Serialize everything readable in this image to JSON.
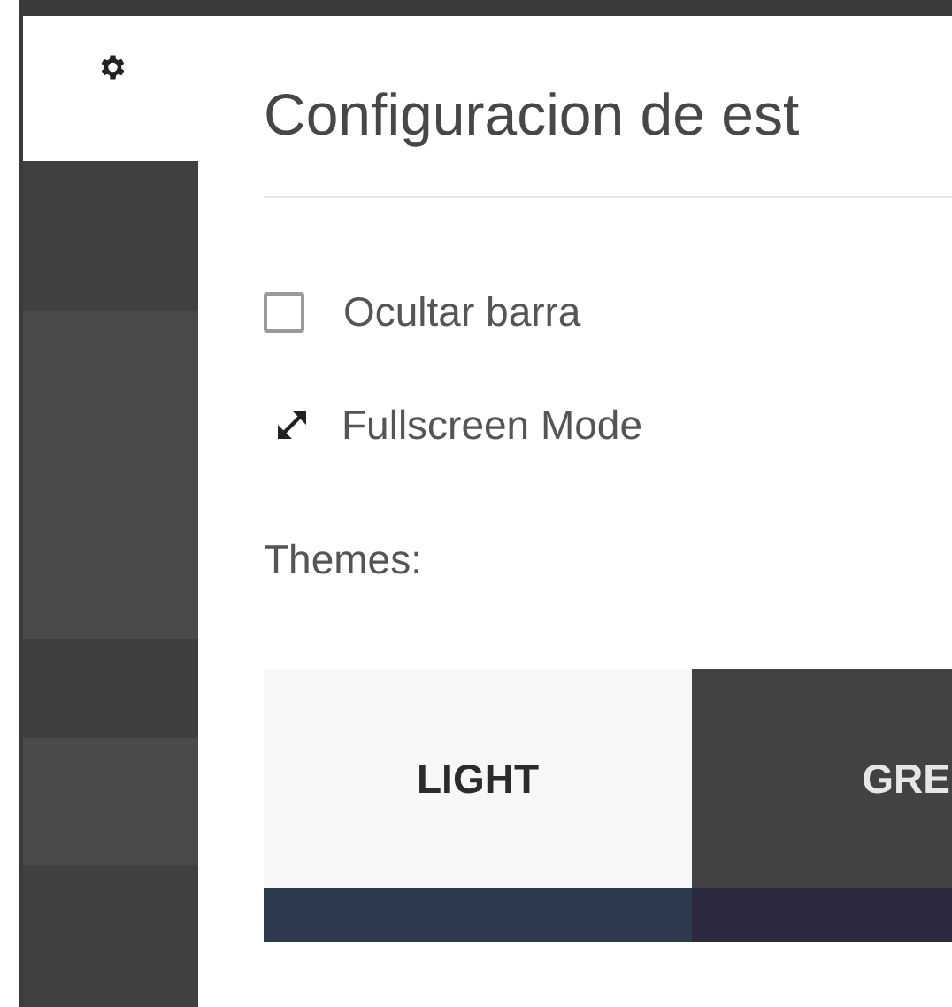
{
  "sidebar": {
    "bands": [
      {
        "color": "#404040"
      },
      {
        "color": "#4a4a4a"
      },
      {
        "color": "#3f3f3f"
      },
      {
        "color": "#4a4a4a"
      },
      {
        "color": "#404040"
      }
    ]
  },
  "panel": {
    "title": "Configuracion de est",
    "options": [
      {
        "kind": "checkbox",
        "label": "Ocultar barra",
        "checked": false
      },
      {
        "kind": "action",
        "label": "Fullscreen Mode"
      }
    ],
    "themes_label": "Themes:",
    "themes": [
      {
        "label": "LIGHT",
        "color": "#f7f7f7"
      },
      {
        "label": "GRE",
        "color": "#424242"
      }
    ],
    "themes_next_row": [
      {
        "color": "#2e3b4e"
      },
      {
        "color": "#2b2a3e"
      }
    ]
  }
}
